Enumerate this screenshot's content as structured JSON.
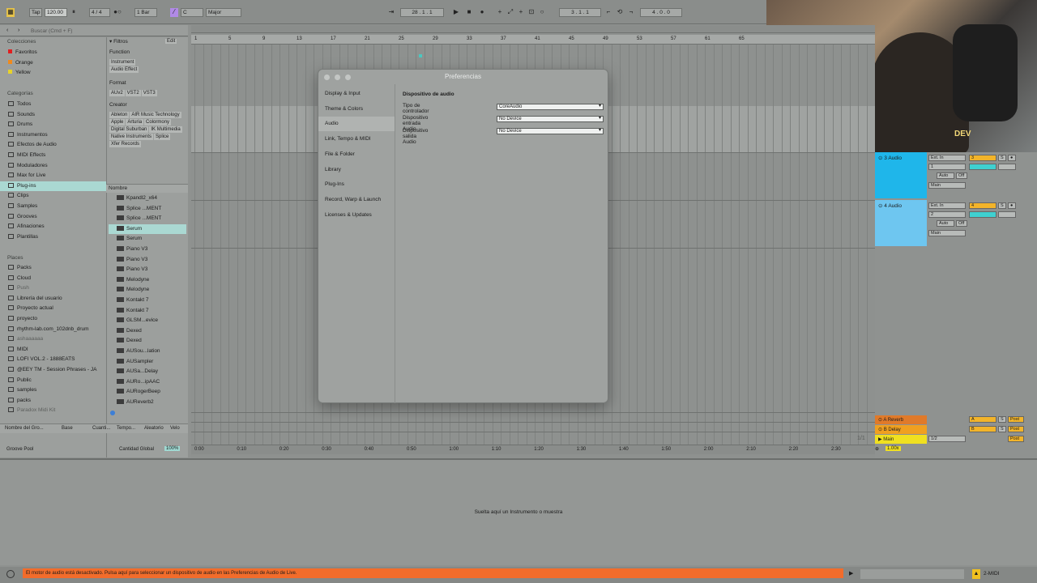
{
  "topbar": {
    "tap": "Tap",
    "tempo": "120.00",
    "signature": "4 / 4",
    "bar": "1 Bar",
    "key": "C",
    "scale": "Major",
    "position": "28 . 1 . 1",
    "loop_start": "3 . 1 . 1",
    "loop_length": "4 . 0 . 0"
  },
  "browser": {
    "search_placeholder": "Buscar (Cmd + F)",
    "collections_header": "Colecciones",
    "collections": [
      {
        "label": "Favoritos",
        "color": "#e02020"
      },
      {
        "label": "Orange",
        "color": "#f08a1c"
      },
      {
        "label": "Yellow",
        "color": "#e8d22a"
      }
    ],
    "categories_header": "Categorías",
    "categories": [
      "Todos",
      "Sounds",
      "Drums",
      "Instrumentos",
      "Efectos de Audio",
      "MIDI Effects",
      "Moduladores",
      "Max for Live",
      "Plug-ins",
      "Clips",
      "Samples",
      "Grooves",
      "Afinaciones",
      "Plantillas"
    ],
    "places_header": "Places",
    "places": [
      "Packs",
      "Cloud",
      "Push",
      "Librería del usuario",
      "Proyecto actual",
      "proyecto",
      "rhythm-lab.com_102dnb_drum",
      "ashaaaaaa",
      "MIDI",
      "LOFI VOL.2 - 1888EATS",
      "@EEY TM - Session Phrases - JA",
      "Public",
      "samples",
      "packs",
      "Paradox Midi Kit"
    ],
    "filters_label": "Filtros",
    "edit_label": "Edit",
    "function_label": "Function",
    "function_tags": [
      "Instrument",
      "Audio Effect"
    ],
    "format_label": "Format",
    "format_tags": [
      "AUv2",
      "VST2",
      "VST3"
    ],
    "creator_label": "Creator",
    "creator_tags": [
      "Ableton",
      "AIR Music Technology",
      "Apple",
      "Arturia",
      "Colormony",
      "Digital Suburban",
      "IK Multimedia",
      "Native Instruments",
      "Splice",
      "Xfer Records"
    ],
    "name_header": "Nombre",
    "plugins": [
      "Kpandl2_x64",
      "Splice ...MENT",
      "Splice ...MENT",
      "Serum",
      "Serum",
      "Piano V3",
      "Piano V3",
      "Piano V3",
      "Melodyne",
      "Melodyne",
      "Kontakt 7",
      "Kontakt 7",
      "GLSM...evice",
      "Dexed",
      "Dexed",
      "AUSou...lation",
      "AUSampler",
      "AUSa...Delay",
      "AURo...ipAAC",
      "AURogerBeep",
      "AUReverb2"
    ],
    "selected_plugin_index": 3,
    "groove_cols": [
      "Nombre del Gro...",
      "Base",
      "Cuanti...",
      "Tempo...",
      "Aleatorio",
      "Velo"
    ],
    "groove_pool": "Groove Pool",
    "cantidad_label": "Cantidad Global",
    "cantidad_value": "100%"
  },
  "ruler": [
    "1",
    "5",
    "9",
    "13",
    "17",
    "21",
    "25",
    "29",
    "33",
    "37",
    "41",
    "45",
    "49",
    "53",
    "57",
    "61",
    "65"
  ],
  "timeline": [
    "0:00",
    "0:10",
    "0:20",
    "0:30",
    "0:40",
    "0:50",
    "1:00",
    "1:10",
    "1:20",
    "1:30",
    "1:40",
    "1:50",
    "2:00",
    "2:10",
    "2:20",
    "2:30"
  ],
  "mixer": {
    "tracks": [
      {
        "name": "3 Audio",
        "color": "#1fb6ea",
        "input": "Ext. In",
        "channel": "1",
        "num": "3",
        "output": "Main"
      },
      {
        "name": "4 Audio",
        "color": "#6ec6f0",
        "input": "Ext. In",
        "channel": "2",
        "num": "4",
        "output": "Main"
      }
    ],
    "auto_label": "Auto",
    "off_label": "Off",
    "returns": [
      {
        "name": "A Reverb",
        "color": "#e07a2a",
        "letter": "A",
        "post": "Post"
      },
      {
        "name": "B Delay",
        "color": "#f0a020",
        "letter": "B",
        "post": "Post"
      }
    ],
    "main": {
      "name": "Main",
      "color": "#f0e020",
      "cue": "1/2",
      "post": "Post"
    },
    "zoom": "1.00x",
    "fraction": "1/1"
  },
  "dialog": {
    "title": "Preferencias",
    "menu": [
      "Display & Input",
      "Theme & Colors",
      "Audio",
      "Link, Tempo & MIDI",
      "File & Folder",
      "Library",
      "Plug-Ins",
      "Record, Warp & Launch",
      "Licenses & Updates"
    ],
    "active_menu": "Audio",
    "section_title": "Dispositivo de audio",
    "rows": [
      {
        "label": "Tipo de controlador",
        "value": "CoreAudio"
      },
      {
        "label": "Dispositivo entrada Audio",
        "value": "No Device"
      },
      {
        "label": "Dispositivo salida Audio",
        "value": "No Device"
      }
    ]
  },
  "detail": {
    "drop_text": "Suelta aquí un Instrumento o muestra"
  },
  "status": {
    "warning": "El motor de audio está desactivado. Pulsa aquí para seleccionar un dispositivo de audio en las Preferencias de Audio de Live.",
    "midi_label": "2-MIDI"
  },
  "webcam": {
    "overlay": "DEV"
  }
}
